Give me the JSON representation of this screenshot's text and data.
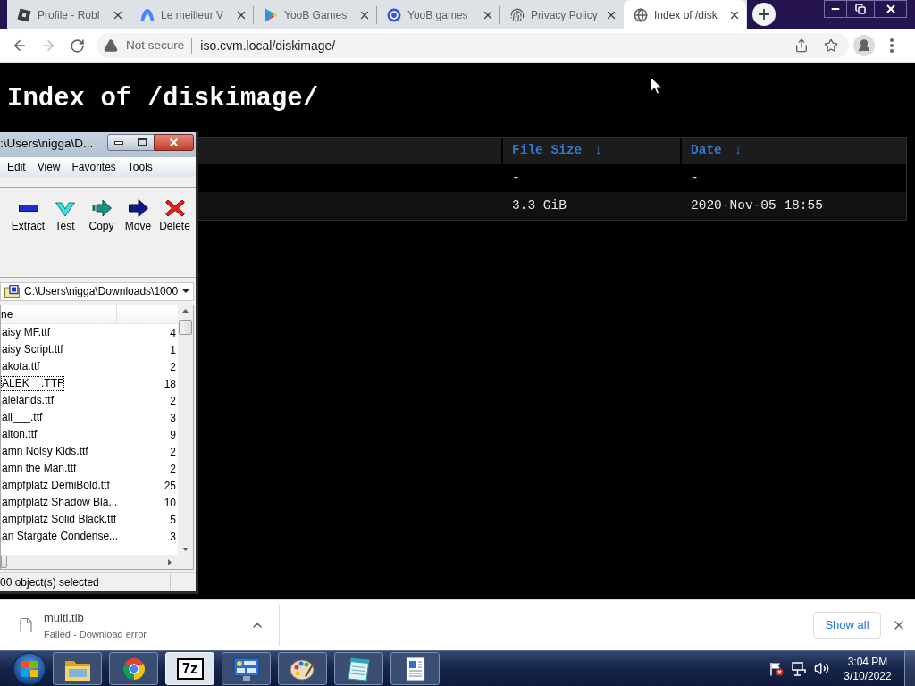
{
  "browser": {
    "tabs": [
      {
        "title": "Profile - Robl",
        "selected": false
      },
      {
        "title": "Le meilleur V",
        "selected": false
      },
      {
        "title": "YooB Games",
        "selected": false
      },
      {
        "title": "YooB games",
        "selected": false
      },
      {
        "title": "Privacy Policy",
        "selected": false
      },
      {
        "title": "Index of /disk",
        "selected": true
      }
    ],
    "address_bar": {
      "security": "Not secure",
      "url": "iso.cvm.local/diskimage/"
    }
  },
  "page": {
    "heading": "Index of /diskimage/",
    "table": {
      "columns": [
        {
          "label": "File Size",
          "sort": "↓"
        },
        {
          "label": "Date",
          "sort": "↓"
        }
      ],
      "rows": [
        {
          "file_size": "-",
          "date": "-"
        },
        {
          "file_size": "3.3 GiB",
          "date": "2020-Nov-05 18:55"
        }
      ]
    }
  },
  "archive_window": {
    "title": ":\\Users\\nigga\\D...",
    "menu": [
      "Edit",
      "View",
      "Favorites",
      "Tools"
    ],
    "toolbar": [
      "Extract",
      "Test",
      "Copy",
      "Move",
      "Delete"
    ],
    "path": "C:\\Users\\nigga\\Downloads\\1000",
    "list": {
      "columns": [
        "ne"
      ],
      "rows": [
        {
          "name": "aisy MF.ttf",
          "size": "4",
          "focused": false
        },
        {
          "name": "aisy Script.ttf",
          "size": "1",
          "focused": false
        },
        {
          "name": "akota.ttf",
          "size": "2",
          "focused": false
        },
        {
          "name": "ALEK__.TTF",
          "size": "18",
          "focused": true
        },
        {
          "name": "alelands.ttf",
          "size": "2",
          "focused": false
        },
        {
          "name": "ali___.ttf",
          "size": "3",
          "focused": false
        },
        {
          "name": "alton.ttf",
          "size": "9",
          "focused": false
        },
        {
          "name": "amn Noisy Kids.ttf",
          "size": "2",
          "focused": false
        },
        {
          "name": "amn the Man.ttf",
          "size": "2",
          "focused": false
        },
        {
          "name": "ampfplatz DemiBold.ttf",
          "size": "25",
          "focused": false
        },
        {
          "name": "ampfplatz Shadow Bla...",
          "size": "10",
          "focused": false
        },
        {
          "name": "ampfplatz Solid Black.ttf",
          "size": "5",
          "focused": false
        },
        {
          "name": "an Stargate Condense...",
          "size": "3",
          "focused": false
        }
      ]
    },
    "status": "00 object(s) selected"
  },
  "downloads_bar": {
    "file": "multi.tib",
    "status": "Failed - Download error",
    "show_all": "Show all"
  },
  "taskbar": {
    "apps": [
      {
        "kind": "explorer",
        "active": false
      },
      {
        "kind": "browser",
        "active": false
      },
      {
        "kind": "archiver",
        "label": "7z",
        "active": true
      },
      {
        "kind": "control-panel",
        "active": false
      },
      {
        "kind": "paint",
        "active": false
      },
      {
        "kind": "notepad",
        "active": false
      },
      {
        "kind": "wordpad",
        "active": false
      }
    ],
    "clock": {
      "time": "3:04 PM",
      "date": "3/10/2022"
    }
  }
}
